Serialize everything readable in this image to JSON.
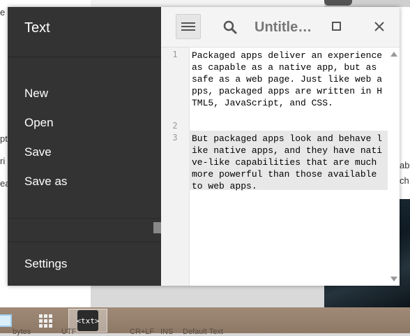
{
  "background": {
    "left_fragments": [
      "e",
      "pt",
      "ri",
      "ea"
    ],
    "right_fragments": [
      "ab",
      "ch"
    ]
  },
  "sidebar": {
    "title": "Text",
    "items": [
      {
        "label": "New"
      },
      {
        "label": "Open"
      },
      {
        "label": "Save"
      },
      {
        "label": "Save as"
      }
    ],
    "settings_label": "Settings"
  },
  "toolbar": {
    "title": "Untitle…",
    "menu_icon": "hamburger-icon",
    "search_icon": "search-icon",
    "maximize_icon": "maximize-icon",
    "close_icon": "close-icon"
  },
  "editor": {
    "lines": [
      {
        "number": "1",
        "text": "Packaged apps deliver an experience as capable as a native app, but as safe as a web page. Just like web apps, packaged apps are written in HTML5, JavaScript, and CSS."
      },
      {
        "number": "2",
        "text": ""
      },
      {
        "number": "3",
        "text": "But packaged apps look and behave like native apps, and they have native-like capabilities that are much more powerful than those available to web apps."
      }
    ]
  },
  "taskbar": {
    "text_app_label": "<txt>",
    "status": [
      "bytes",
      "UTF",
      "CR+LF",
      "INS",
      "Default Text"
    ]
  },
  "colors": {
    "sidebar_bg": "#333333",
    "toolbar_bg": "#f4f4f4",
    "highlight_line": "#e8e8e8",
    "taskbar_bg": "#9a8572"
  }
}
